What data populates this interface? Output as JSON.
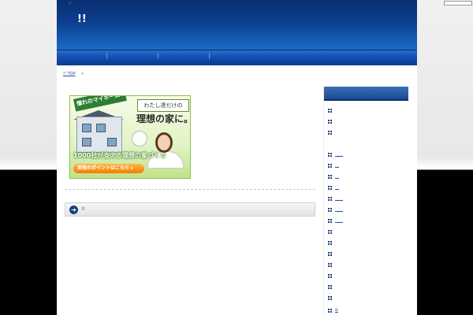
{
  "header": {
    "tagline": "!!",
    "site_title": "!!"
  },
  "breadcrumb": {
    "home": "!! TOP",
    "separator": "»"
  },
  "banner": {
    "ribbon": "憧れのマイホーム",
    "heading1": "わたし達だけの",
    "heading2": "理想の家に。",
    "promo": "1000社が支える理想の家づくり",
    "cta": "実現のポイントはこちら ▸"
  },
  "post": {
    "title": "!!"
  },
  "sidebar": {
    "items": [
      {
        "label": ""
      },
      {
        "label": ""
      },
      {
        "label": ""
      },
      {
        "label": "____"
      },
      {
        "label": "__"
      },
      {
        "label": "__"
      },
      {
        "label": "__"
      },
      {
        "label": "____"
      },
      {
        "label": "____"
      },
      {
        "label": "____"
      },
      {
        "label": ""
      },
      {
        "label": ""
      },
      {
        "label": ""
      },
      {
        "label": ""
      },
      {
        "label": ""
      },
      {
        "label": ""
      },
      {
        "label": ""
      },
      {
        "label": "&"
      }
    ]
  },
  "colors": {
    "header_top": "#0a2f72",
    "header_bottom": "#1a6cc6",
    "nav": "#1451b3",
    "link": "#1a4fa0",
    "banner_green": "#8bc34a",
    "cta_orange": "#f57c00"
  }
}
